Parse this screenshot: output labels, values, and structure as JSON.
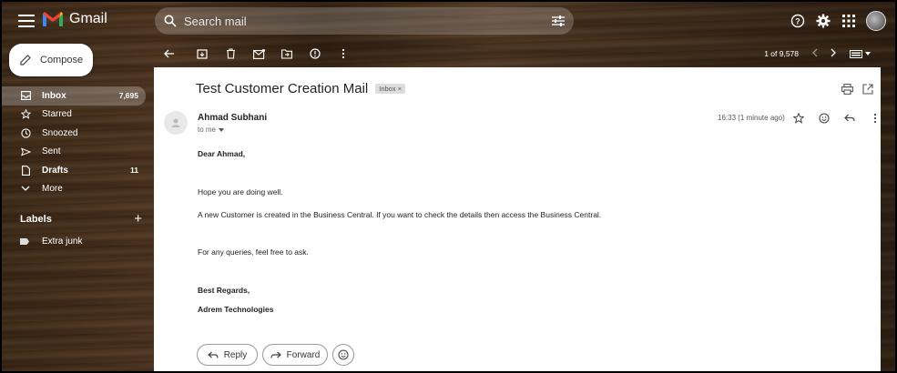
{
  "app": {
    "name": "Gmail"
  },
  "search": {
    "placeholder": "Search mail"
  },
  "sidebar": {
    "compose_label": "Compose",
    "items": [
      {
        "label": "Inbox",
        "count": "7,695",
        "icon": "inbox-icon"
      },
      {
        "label": "Starred",
        "count": "",
        "icon": "star-icon"
      },
      {
        "label": "Snoozed",
        "count": "",
        "icon": "clock-icon"
      },
      {
        "label": "Sent",
        "count": "",
        "icon": "send-icon"
      },
      {
        "label": "Drafts",
        "count": "11",
        "icon": "draft-icon"
      },
      {
        "label": "More",
        "count": "",
        "icon": "chevron-down-icon"
      }
    ],
    "labels_title": "Labels",
    "labels": [
      {
        "label": "Extra junk"
      }
    ]
  },
  "toolbar": {
    "pagination": "1 of 9,578"
  },
  "message": {
    "subject": "Test Customer Creation Mail",
    "chip": "Inbox",
    "chip_close": "×",
    "sender": "Ahmad Subhani",
    "to": "to me",
    "time": "16:33 (1 minute ago)",
    "greeting": "Dear Ahmad,",
    "line1": "Hope you are doing well.",
    "line2": "A new Customer is created in the Business Central. If you want to check the details then access the Business Central.",
    "line3": "For any queries, feel free to ask.",
    "signoff": "Best Regards,",
    "company": "Adrem Technologies"
  },
  "actions": {
    "reply": "Reply",
    "forward": "Forward"
  },
  "colors": {
    "gmail_red": "#EA4335",
    "panel_bg": "#ffffff",
    "text": "#222222"
  }
}
